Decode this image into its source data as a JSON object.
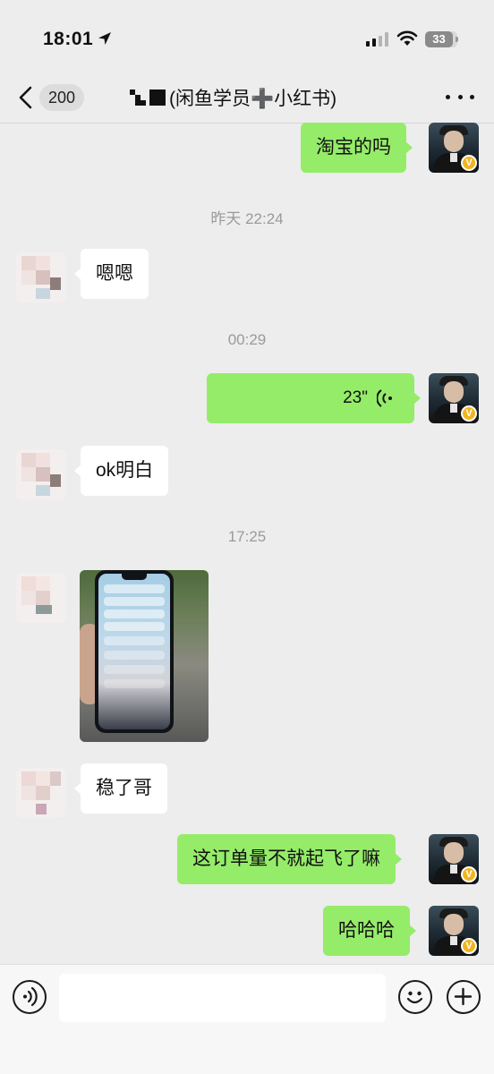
{
  "status_bar": {
    "time": "18:01",
    "battery": "33",
    "icons": [
      "location-arrow-icon",
      "signal-icon",
      "wifi-icon",
      "battery-icon"
    ]
  },
  "nav": {
    "back_icon": "chevron-left-icon",
    "unread_count": "200",
    "title": "(闲鱼学员➕小红书)",
    "more_icon": "more-dots-icon"
  },
  "messages": [
    {
      "side": "right",
      "type": "text",
      "text": "淘宝的吗"
    },
    {
      "type": "timestamp",
      "text": "昨天 22:24"
    },
    {
      "side": "left",
      "type": "text",
      "text": "嗯嗯"
    },
    {
      "type": "timestamp",
      "text": "00:29"
    },
    {
      "side": "right",
      "type": "voice",
      "duration": "23\""
    },
    {
      "side": "left",
      "type": "text",
      "text": "ok明白"
    },
    {
      "type": "timestamp",
      "text": "17:25"
    },
    {
      "side": "left",
      "type": "image"
    },
    {
      "side": "left",
      "type": "text",
      "text": "稳了哥"
    },
    {
      "side": "right",
      "type": "text",
      "text": "这订单量不就起飞了嘛"
    },
    {
      "side": "right",
      "type": "text",
      "text": "哈哈哈"
    }
  ],
  "avatar_badge": "V",
  "input_bar": {
    "voice_icon": "voice-input-icon",
    "emoji_icon": "emoji-icon",
    "plus_icon": "plus-icon",
    "value": ""
  },
  "colors": {
    "background": "#ededed",
    "bubble_self": "#95ec69",
    "bubble_other": "#ffffff",
    "badge": "#f2b51f"
  }
}
